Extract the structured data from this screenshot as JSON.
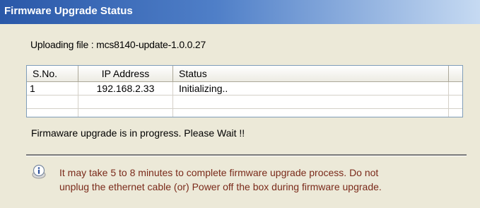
{
  "window": {
    "title": "Firmware Upgrade Status"
  },
  "upload": {
    "text": "Uploading file : mcs8140-update-1.0.0.27"
  },
  "table": {
    "headers": [
      "S.No.",
      "IP Address",
      "Status"
    ],
    "rows": [
      {
        "sno": "1",
        "ip": "192.168.2.33",
        "status": "Initializing.."
      }
    ]
  },
  "progress": {
    "text": "Firmaware upgrade is in progress. Please Wait !!"
  },
  "note": {
    "icon": "info-icon",
    "line1": "It may take 5 to 8 minutes to complete firmware upgrade process. Do not",
    "line2": "unplug the ethernet cable (or) Power off the box during firmware upgrade."
  }
}
